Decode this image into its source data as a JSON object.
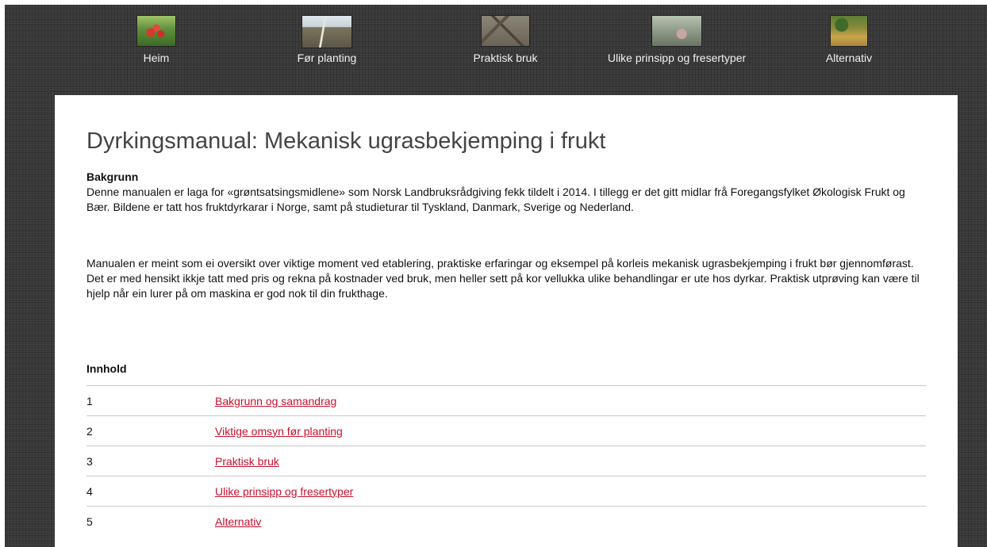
{
  "nav": {
    "items": [
      {
        "label": "Heim",
        "image": "red-apples-on-tree"
      },
      {
        "label": "Før planting",
        "image": "planted-field-rows"
      },
      {
        "label": "Praktisk bruk",
        "image": "soil-with-branches"
      },
      {
        "label": "Ulike prinsipp og fresertyper",
        "image": "orchard-ground-machine"
      },
      {
        "label": "Alternativ",
        "image": "orchard-ground-grass"
      }
    ]
  },
  "main": {
    "title": "Dyrkingsmanual: Mekanisk ugrasbekjemping i frukt",
    "section_heading": "Bakgrunn",
    "paragraphs": [
      "Denne manualen er laga for «grøntsatsingsmidlene» som Norsk Landbruksrådgiving fekk tildelt i 2014. I tillegg er det gitt midlar frå Foregangsfylket Økologisk Frukt og Bær. Bildene er tatt hos fruktdyrkarar i Norge, samt på studieturar til Tyskland, Danmark, Sverige og Nederland.",
      "Manualen er meint som ei oversikt over viktige moment ved etablering, praktiske erfaringar og eksempel på korleis mekanisk ugrasbekjemping i frukt bør gjennomførast. Det er med hensikt ikkje tatt med pris og rekna på kostnader ved bruk, men heller sett på kor vellukka ulike behandlingar er ute hos dyrkar. Praktisk utprøving kan være til hjelp når ein lurer på om maskina er god nok til din frukthage."
    ],
    "toc": {
      "heading": "Innhold",
      "rows": [
        {
          "num": "1",
          "label": "Bakgrunn og samandrag"
        },
        {
          "num": "2",
          "label": "Viktige omsyn før planting"
        },
        {
          "num": "3",
          "label": "Praktisk bruk"
        },
        {
          "num": "4",
          "label": "Ulike prinsipp og fresertyper"
        },
        {
          "num": "5",
          "label": "Alternativ"
        }
      ]
    }
  },
  "colors": {
    "link": "#c8102e",
    "background": "#3a3a3a",
    "content": "#ffffff"
  }
}
